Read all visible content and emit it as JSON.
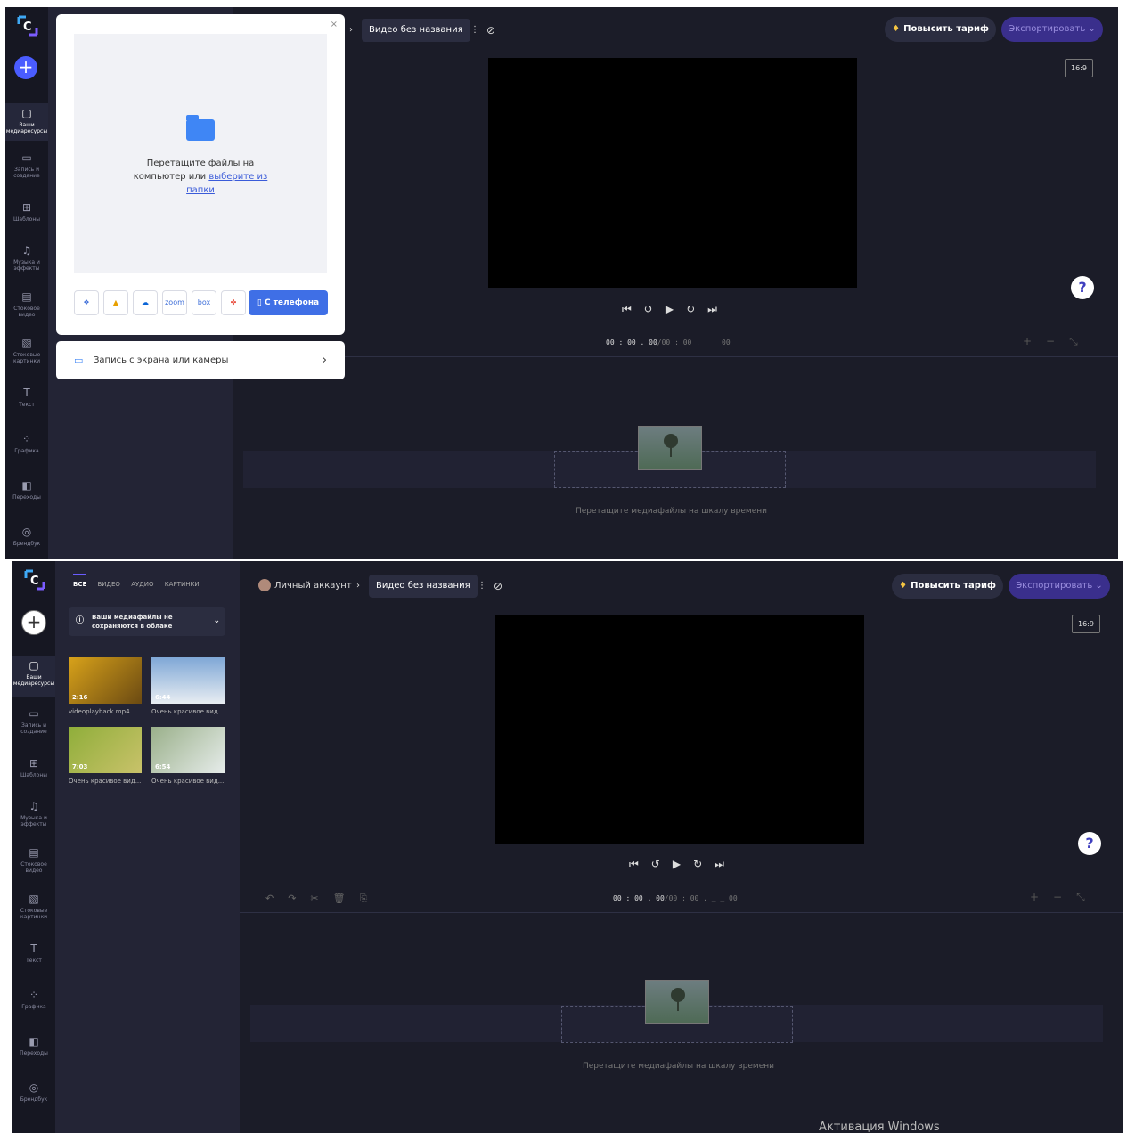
{
  "app": {
    "logo_letter": "C",
    "project_title": "Видео без названия",
    "account_label": "Личный аккаунт",
    "upgrade_label": "Повысить тариф",
    "export_label": "Экспортировать",
    "aspect_ratio": "16:9",
    "help_label": "?",
    "drop_hint": "Перетащите медиафайлы на шкалу времени",
    "activation_text": "Активация Windows"
  },
  "rail": {
    "items": [
      {
        "label": "Ваши медиаресурсы",
        "icon": "folder-icon"
      },
      {
        "label": "Запись и создание",
        "icon": "camera-icon"
      },
      {
        "label": "Шаблоны",
        "icon": "templates-icon"
      },
      {
        "label": "Музыка и эффекты",
        "icon": "music-icon"
      },
      {
        "label": "Стоковое видео",
        "icon": "film-icon"
      },
      {
        "label": "Стоковые картинки",
        "icon": "image-icon"
      },
      {
        "label": "Текст",
        "icon": "text-icon"
      },
      {
        "label": "Графика",
        "icon": "shapes-icon"
      },
      {
        "label": "Переходы",
        "icon": "transitions-icon"
      },
      {
        "label": "Брендбук",
        "icon": "brand-icon"
      }
    ]
  },
  "import_popup": {
    "drop_text_1": "Перетащите файлы на компьютер или",
    "drop_link": "выберите из папки",
    "services": [
      "dropbox",
      "google-drive",
      "onedrive",
      "zoom",
      "box",
      "google-photos"
    ],
    "zoom_label": "zoom",
    "box_label": "box",
    "phone_button": "С телефона",
    "record_label": "Запись с экрана или камеры"
  },
  "timecode": {
    "current": "00 : 00 . 00",
    "total": "/00 : 00 . _ _ 00"
  },
  "media_panel": {
    "tabs": [
      "ВСЕ",
      "ВИДЕО",
      "АУДИО",
      "КАРТИНКИ"
    ],
    "notice": "Ваши медиафайлы не сохраняются в облаке",
    "items": [
      {
        "name": "videoplayback.mp4",
        "duration": "2:16",
        "color_a": "#d8a21a",
        "color_b": "#6b4a12"
      },
      {
        "name": "Очень красивое вид...",
        "duration": "6:44",
        "color_a": "#7fa7d6",
        "color_b": "#e8edf2"
      },
      {
        "name": "Очень красивое вид...",
        "duration": "7:03",
        "color_a": "#8fae3a",
        "color_b": "#c9c26a"
      },
      {
        "name": "Очень красивое вид...",
        "duration": "6:54",
        "color_a": "#9ab08a",
        "color_b": "#e6ecea"
      }
    ]
  }
}
